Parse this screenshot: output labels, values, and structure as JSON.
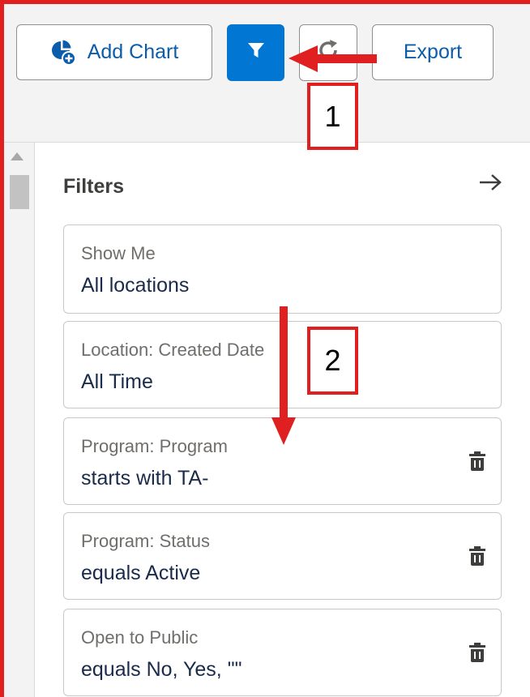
{
  "toolbar": {
    "add_chart_label": "Add Chart",
    "export_label": "Export",
    "icons": {
      "add_chart": "add-chart-icon",
      "filter": "filter-icon",
      "refresh": "refresh-icon"
    }
  },
  "panel": {
    "title": "Filters",
    "filters": [
      {
        "label": "Show Me",
        "value": "All locations",
        "removable": false
      },
      {
        "label": "Location: Created Date",
        "value": "All Time",
        "removable": false
      },
      {
        "label": "Program: Program",
        "value": "starts with TA-",
        "removable": true
      },
      {
        "label": "Program: Status",
        "value": "equals Active",
        "removable": true
      },
      {
        "label": "Open to Public",
        "value": "equals No, Yes, \"\"",
        "removable": true
      }
    ]
  },
  "annotations": {
    "step1": "1",
    "step2": "2"
  },
  "colors": {
    "accent": "#0176d3",
    "annotation": "#e02020",
    "link_text": "#0b5cab"
  }
}
